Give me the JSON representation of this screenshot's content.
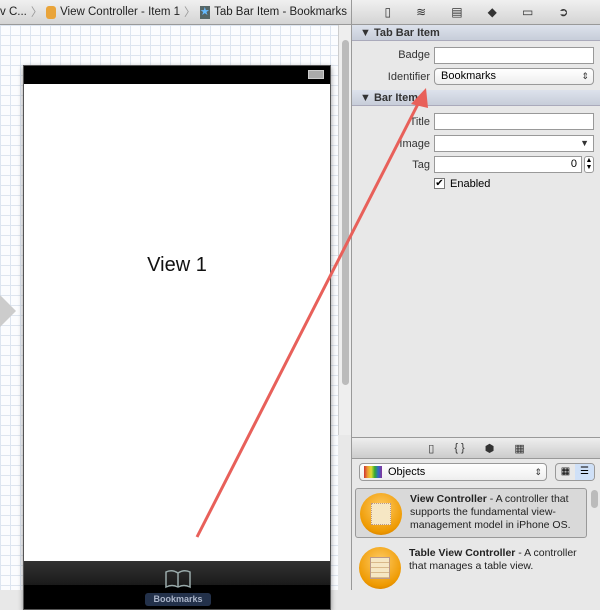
{
  "jumpbar": {
    "items": [
      "v C...",
      "View Controller - Item 1",
      "Tab Bar Item - Bookmarks"
    ],
    "separator": "〉"
  },
  "canvas": {
    "view_label": "View 1",
    "tab_label": "Bookmarks"
  },
  "inspector": {
    "toolbar_icons": [
      "file-icon",
      "quick-help-icon",
      "identity-icon",
      "attributes-icon",
      "size-icon",
      "connections-icon"
    ],
    "tab_bar_item": {
      "header": "Tab Bar Item",
      "badge_label": "Badge",
      "badge_value": "",
      "identifier_label": "Identifier",
      "identifier_value": "Bookmarks"
    },
    "bar_item": {
      "header": "Bar Item",
      "title_label": "Title",
      "title_value": "",
      "image_label": "Image",
      "image_value": "",
      "tag_label": "Tag",
      "tag_value": "0",
      "enabled_label": "Enabled",
      "enabled": true
    }
  },
  "library": {
    "toolbar_icons": [
      "file-template-icon",
      "code-snippet-icon",
      "object-icon",
      "media-icon"
    ],
    "selector": "Objects",
    "items": [
      {
        "name": "View Controller",
        "desc": " - A controller that supports the fundamental view-management model in iPhone OS."
      },
      {
        "name": "Table View Controller",
        "desc": " - A controller that manages a table view."
      }
    ]
  },
  "colors": {
    "arrow": "#e8605a"
  }
}
